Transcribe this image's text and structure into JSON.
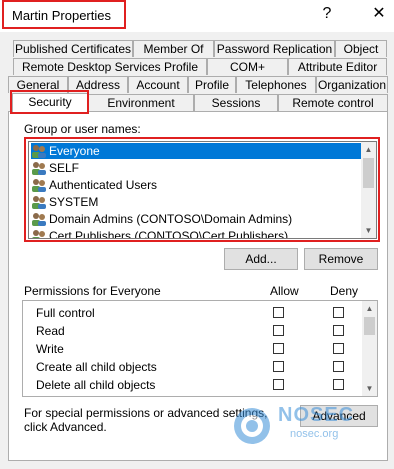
{
  "window": {
    "title": "Martin Properties",
    "help_button": "?",
    "close_button": "✕"
  },
  "tabs": {
    "row1": [
      "Published Certificates",
      "Member Of",
      "Password Replication",
      "Object"
    ],
    "row2": [
      "Remote Desktop Services Profile",
      "COM+",
      "Attribute Editor"
    ],
    "row3": [
      "General",
      "Address",
      "Account",
      "Profile",
      "Telephones",
      "Organization"
    ],
    "row4": [
      "Security",
      "Environment",
      "Sessions",
      "Remote control"
    ],
    "active": "Security"
  },
  "security": {
    "group_label": "Group or user names:",
    "users": [
      "Everyone",
      "SELF",
      "Authenticated Users",
      "SYSTEM",
      "Domain Admins (CONTOSO\\Domain Admins)",
      "Cert Publishers (CONTOSO\\Cert Publishers)"
    ],
    "selected_user": "Everyone",
    "add_button": "Add...",
    "remove_button": "Remove",
    "permissions_label": "Permissions for Everyone",
    "allow_header": "Allow",
    "deny_header": "Deny",
    "permissions": [
      {
        "name": "Full control",
        "allow": false,
        "deny": false
      },
      {
        "name": "Read",
        "allow": false,
        "deny": false
      },
      {
        "name": "Write",
        "allow": false,
        "deny": false
      },
      {
        "name": "Create all child objects",
        "allow": false,
        "deny": false
      },
      {
        "name": "Delete all child objects",
        "allow": false,
        "deny": false
      }
    ],
    "advanced_text": "For special permissions or advanced settings, click Advanced.",
    "advanced_button": "Advanced"
  },
  "watermark": {
    "brand": "NOSEC",
    "site": "nosec.org"
  },
  "colors": {
    "highlight_border": "#e02020",
    "selection": "#0078d7"
  }
}
